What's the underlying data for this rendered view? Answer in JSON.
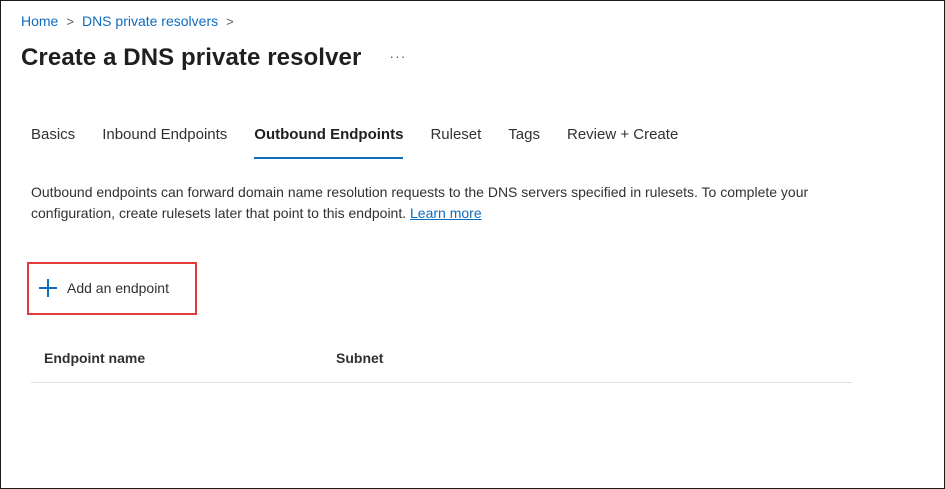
{
  "breadcrumb": {
    "items": [
      {
        "label": "Home"
      },
      {
        "label": "DNS private resolvers"
      }
    ],
    "separator": ">"
  },
  "header": {
    "title": "Create a DNS private resolver",
    "more_label": "···"
  },
  "tabs": [
    {
      "label": "Basics",
      "active": false
    },
    {
      "label": "Inbound Endpoints",
      "active": false
    },
    {
      "label": "Outbound Endpoints",
      "active": true
    },
    {
      "label": "Ruleset",
      "active": false
    },
    {
      "label": "Tags",
      "active": false
    },
    {
      "label": "Review + Create",
      "active": false
    }
  ],
  "main": {
    "description": "Outbound endpoints can forward domain name resolution requests to the DNS servers specified in rulesets. To complete your configuration, create rulesets later that point to this endpoint.",
    "learn_more": "Learn more",
    "add_button": {
      "label": "Add an endpoint",
      "icon": "plus-icon"
    },
    "table": {
      "columns": [
        "Endpoint name",
        "Subnet"
      ],
      "rows": []
    }
  },
  "colors": {
    "accent": "#0f6cbd",
    "highlight": "#e33b3b"
  }
}
